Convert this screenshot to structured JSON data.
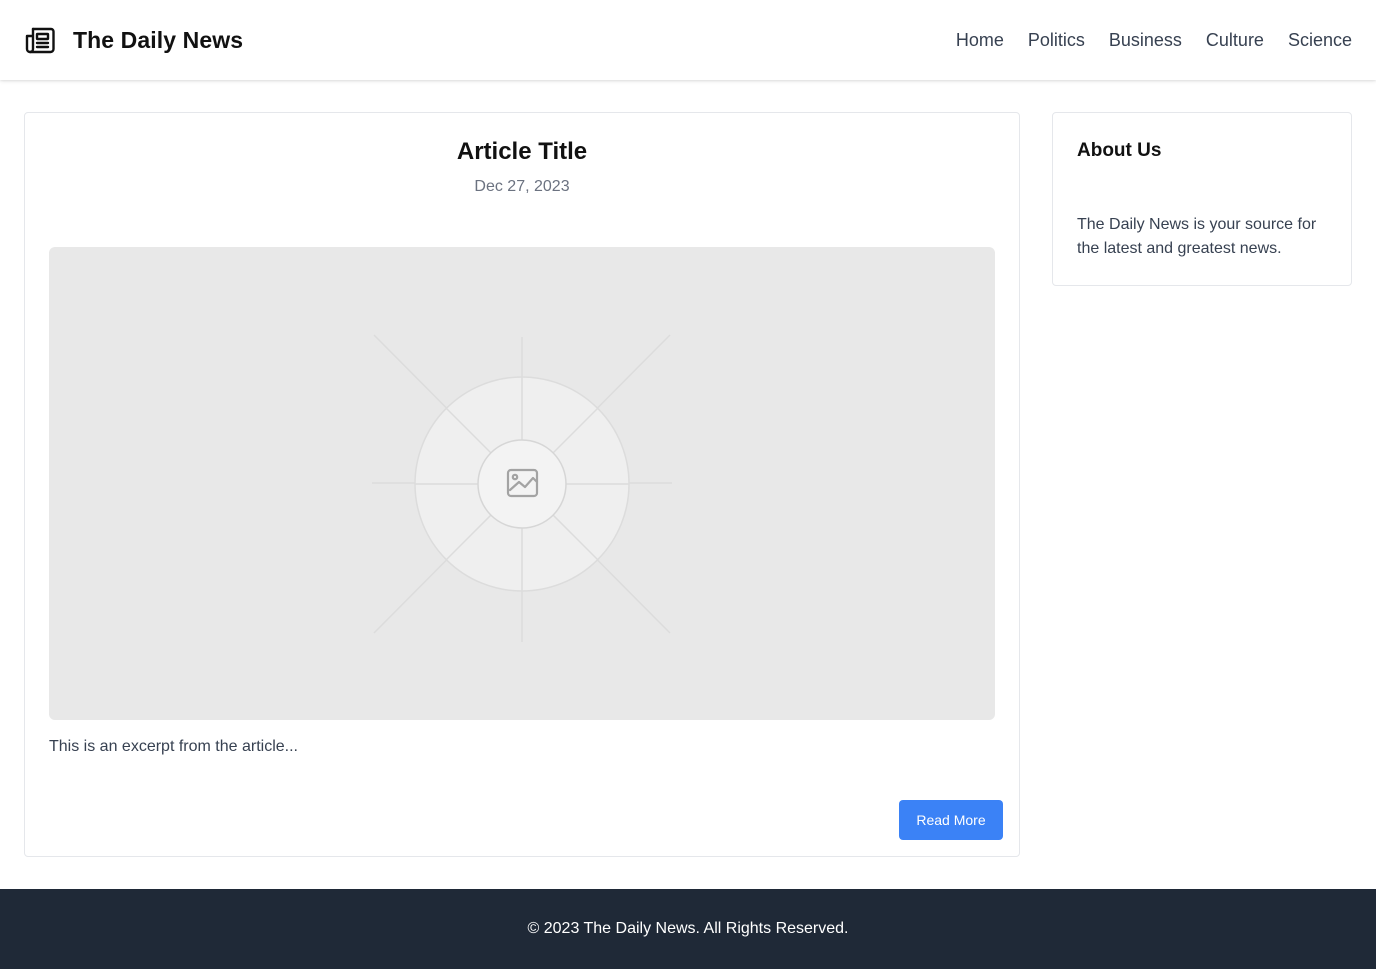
{
  "header": {
    "logo_icon": "newspaper-icon",
    "site_title": "The Daily News",
    "nav": [
      "Home",
      "Politics",
      "Business",
      "Culture",
      "Science"
    ]
  },
  "article": {
    "title": "Article Title",
    "date": "Dec 27, 2023",
    "image_icon": "image-placeholder-icon",
    "excerpt": "This is an excerpt from the article...",
    "read_more_label": "Read More"
  },
  "sidebar": {
    "about_title": "About Us",
    "about_text": "The Daily News is your source for the latest and greatest news."
  },
  "footer": {
    "copyright": "© 2023 The Daily News. All Rights Reserved."
  },
  "colors": {
    "accent": "#3b82f6",
    "footer_bg": "#1f2937",
    "muted_text": "#6b7280",
    "body_text": "#374151",
    "border": "#e5e7eb",
    "image_bg": "#e8e8e8"
  }
}
